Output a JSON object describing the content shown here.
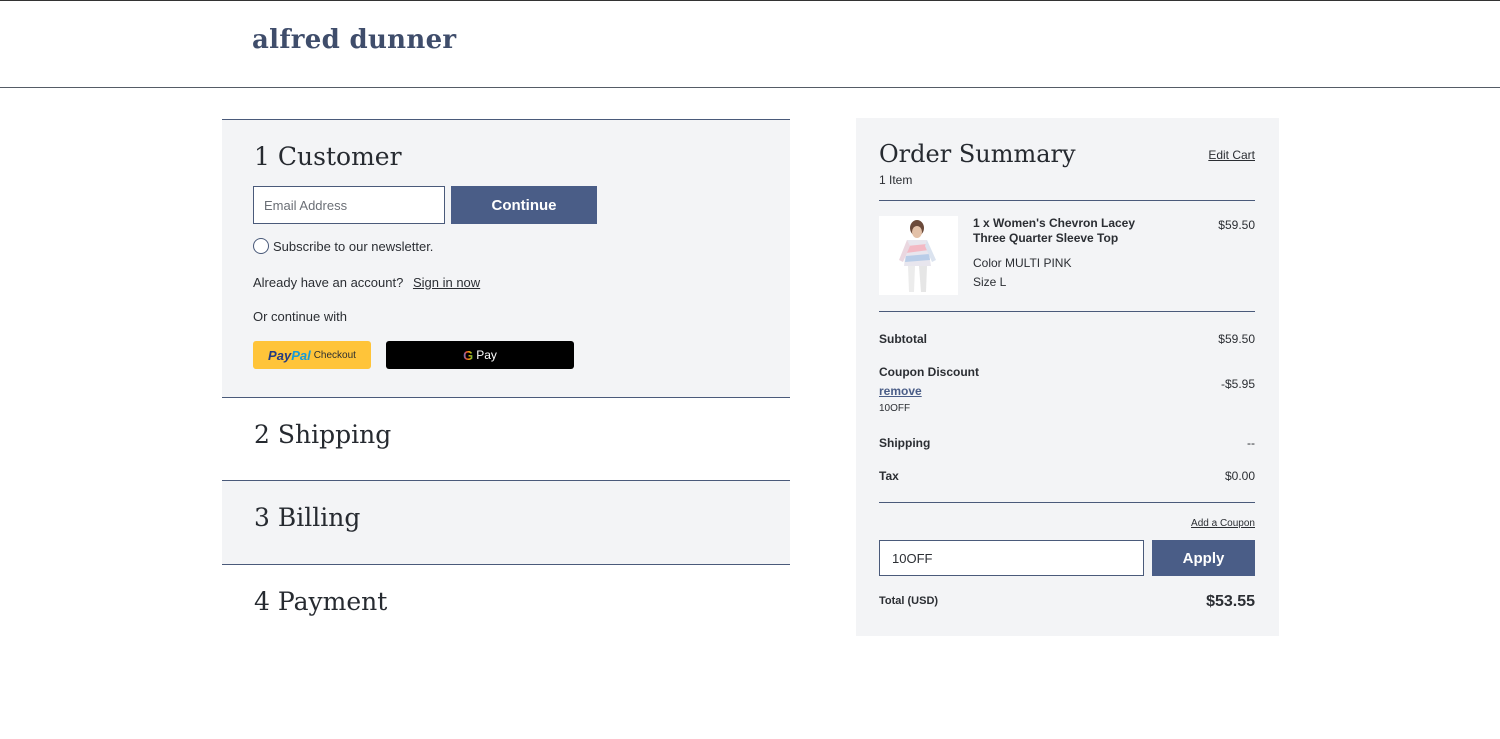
{
  "header": {
    "logo": "alfred dunner"
  },
  "checkout": {
    "steps": [
      {
        "number": "1",
        "label": "Customer"
      },
      {
        "number": "2",
        "label": "Shipping"
      },
      {
        "number": "3",
        "label": "Billing"
      },
      {
        "number": "4",
        "label": "Payment"
      }
    ],
    "customer": {
      "email_placeholder": "Email Address",
      "email_value": "",
      "continue_label": "Continue",
      "newsletter_label": "Subscribe to our newsletter.",
      "account_prompt": "Already have an account?",
      "signin_label": "Sign in now",
      "or_continue": "Or continue with",
      "paypal": {
        "brand_pay": "Pay",
        "brand_pal": "Pal",
        "checkout": "Checkout"
      },
      "gpay": {
        "g": "G",
        "label": "Pay"
      }
    }
  },
  "summary": {
    "title": "Order Summary",
    "edit_cart": "Edit Cart",
    "item_count": "1 Item",
    "product": {
      "name": "1 x Women's Chevron Lacey Three Quarter Sleeve Top",
      "price": "$59.50",
      "color": "Color MULTI PINK",
      "size": "Size L"
    },
    "subtotal_label": "Subtotal",
    "subtotal_value": "$59.50",
    "coupon_label": "Coupon Discount",
    "coupon_value": "-$5.95",
    "remove_label": "remove",
    "coupon_code": "10OFF",
    "shipping_label": "Shipping",
    "shipping_value": "--",
    "tax_label": "Tax",
    "tax_value": "$0.00",
    "add_coupon": "Add a Coupon",
    "coupon_input_value": "10OFF",
    "apply_label": "Apply",
    "total_label": "Total (USD)",
    "total_value": "$53.55"
  },
  "colors": {
    "accent": "#4a5d87",
    "panel": "#f3f4f6",
    "rule": "#4a5a7a"
  },
  "icons": {
    "radio": "radio-circle-icon",
    "gpay": "google-g-icon"
  }
}
